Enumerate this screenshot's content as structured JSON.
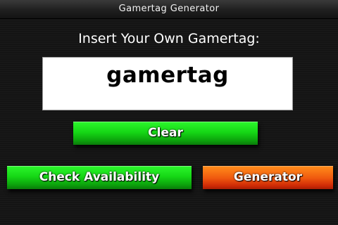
{
  "window": {
    "title": "Gamertag Generator"
  },
  "prompt": {
    "text": "Insert Your Own Gamertag:"
  },
  "gamertag_input": {
    "value": "gamertag"
  },
  "buttons": {
    "clear": "Clear",
    "check_availability": "Check Availability",
    "generator": "Generator"
  },
  "colors": {
    "background": "#141414",
    "green_button": "#15d615",
    "orange_button": "#f05a0f"
  }
}
